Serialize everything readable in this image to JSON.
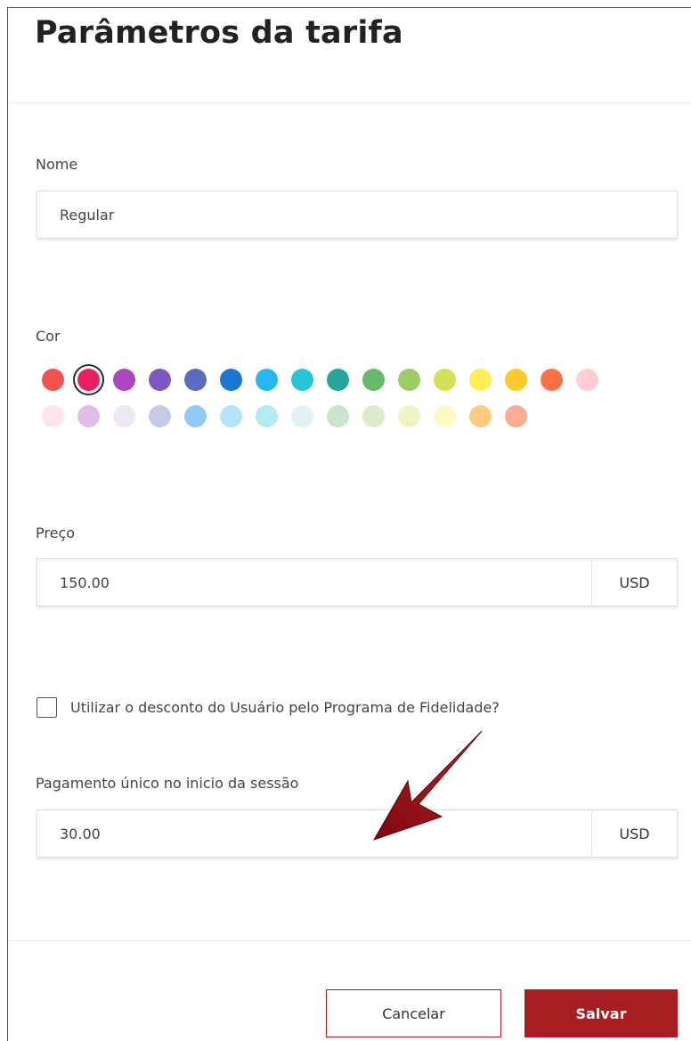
{
  "dialog": {
    "title": "Parâmetros da tarifa"
  },
  "form": {
    "name": {
      "label": "Nome",
      "value": "Regular"
    },
    "color": {
      "label": "Cor",
      "selected_index": 1,
      "swatches": [
        "#ef5350",
        "#e91e63",
        "#ab47bc",
        "#7e57c2",
        "#5c6bc0",
        "#1976d2",
        "#29b6f6",
        "#26c6da",
        "#26a69a",
        "#66bb6a",
        "#9ccc65",
        "#d4e157",
        "#ffee58",
        "#ffca28",
        "#ff7043",
        "#ffcdd2",
        "#fce4ec",
        "#e1bee7",
        "#ede7f6",
        "#c5cae9",
        "#90caf9",
        "#b3e5fc",
        "#b2ebf2",
        "#e0f2f1",
        "#c8e6c9",
        "#dcedc8",
        "#f0f4c3",
        "#fff9c4",
        "#ffcc80",
        "#ffab91"
      ]
    },
    "price": {
      "label": "Preço",
      "value": "150.00",
      "currency": "USD"
    },
    "loyalty": {
      "label": "Utilizar o desconto do Usuário pelo Programa de Fidelidade?",
      "checked": false
    },
    "one_time_payment": {
      "label": "Pagamento único no inicio da sessão",
      "value": "30.00",
      "currency": "USD"
    }
  },
  "buttons": {
    "cancel": "Cancelar",
    "save": "Salvar"
  },
  "colors": {
    "accent": "#a61e22",
    "arrow": "#8f0d12"
  },
  "annotation": {
    "icon": "arrow-icon",
    "target": "one_time_payment"
  }
}
